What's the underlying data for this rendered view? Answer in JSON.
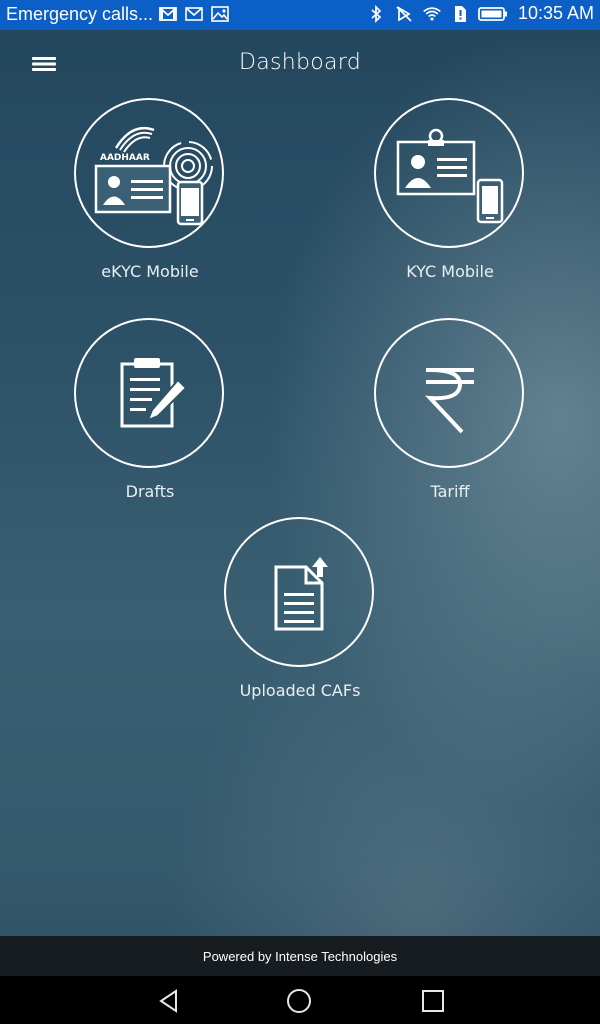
{
  "status_bar": {
    "notification_title": "Emergency calls...",
    "time": "10:35 AM",
    "left_icons": [
      "gmail-icon",
      "email-icon",
      "image-icon"
    ],
    "right_icons": [
      "bluetooth-icon",
      "vibrate-off-icon",
      "wifi-icon",
      "sim-alert-icon",
      "battery-icon"
    ]
  },
  "header": {
    "title": "Dashboard",
    "menu_icon": "hamburger-menu-icon"
  },
  "tiles": [
    {
      "label": "eKYC Mobile",
      "icon": "aadhaar-card-mobile-icon",
      "badge_text": "AADHAAR"
    },
    {
      "label": "KYC Mobile",
      "icon": "id-card-mobile-icon"
    },
    {
      "label": "Drafts",
      "icon": "clipboard-pen-icon"
    },
    {
      "label": "Tariff",
      "icon": "rupee-icon"
    },
    {
      "label": "Uploaded CAFs",
      "icon": "document-upload-icon"
    }
  ],
  "footer": {
    "text": "Powered by Intense Technologies"
  },
  "nav": {
    "back": "back-triangle-icon",
    "home": "home-circle-icon",
    "recents": "recents-square-icon"
  },
  "colors": {
    "status_bar": "#0c5fc6",
    "footer": "#161c20",
    "icon_stroke": "#ffffff"
  }
}
